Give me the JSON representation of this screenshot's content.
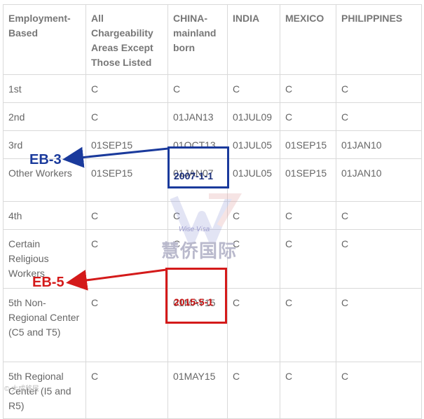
{
  "table": {
    "headers": [
      "Employment-Based",
      "All Chargeability Areas Except Those Listed",
      "CHINA-mainland born",
      "INDIA",
      "MEXICO",
      "PHILIPPINES"
    ],
    "rows": [
      [
        "1st",
        "C",
        "C",
        "C",
        "C",
        "C"
      ],
      [
        "2nd",
        "C",
        "01JAN13",
        "01JUL09",
        "C",
        "C"
      ],
      [
        "3rd",
        "01SEP15",
        "01OCT13",
        "01JUL05",
        "01SEP15",
        "01JAN10"
      ],
      [
        "Other Workers",
        "01SEP15",
        "01JAN07",
        "01JUL05",
        "01SEP15",
        "01JAN10"
      ],
      [
        "4th",
        "C",
        "C",
        "C",
        "C",
        "C"
      ],
      [
        "Certain Religious Workers",
        "C",
        "C",
        "C",
        "C",
        "C"
      ],
      [
        "5th Non-Regional Center (C5 and T5)",
        "C",
        "01MAY15",
        "C",
        "C",
        "C"
      ],
      [
        "5th Regional Center (I5 and R5)",
        "C",
        "01MAY15",
        "C",
        "C",
        "C"
      ]
    ]
  },
  "annotations": {
    "eb3_label": "EB-3",
    "eb3_date": "2007-1-1",
    "eb5_label": "EB-5",
    "eb5_date": "2015-5-1",
    "colors": {
      "blue": "#1a3a9c",
      "red": "#d41a1a"
    }
  },
  "watermark": {
    "brand_en": "Wise Visa",
    "brand_cn": "慧侨国际",
    "corner": "© 大成移民"
  }
}
